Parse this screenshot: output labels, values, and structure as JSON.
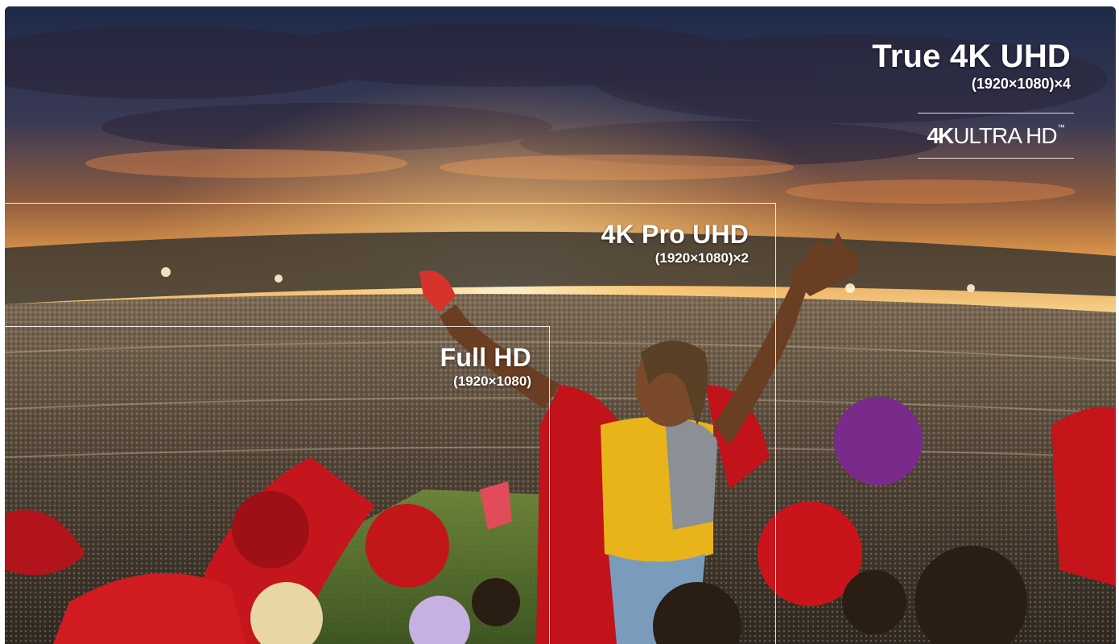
{
  "labels": {
    "true_4k": {
      "name": "True 4K UHD",
      "dims": "(1920×1080)×4"
    },
    "pro_4k": {
      "name": "4K Pro UHD",
      "dims": "(1920×1080)×2"
    },
    "full_hd": {
      "name": "Full HD",
      "dims": "(1920×1080)"
    }
  },
  "badge": {
    "logo_4k": "4K",
    "logo_text": "ULTRA HD",
    "tm": "™"
  },
  "colors": {
    "label_text": "#ffffff",
    "box_line": "#ffffff"
  }
}
